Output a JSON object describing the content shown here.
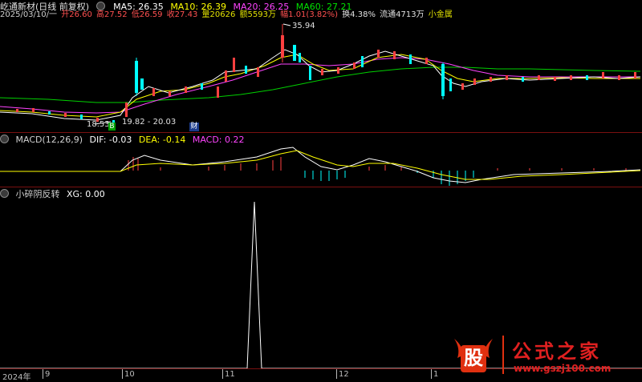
{
  "header": {
    "stock_name": "屹通新材(日线 前复权)",
    "ma5": "MA5: 26.35",
    "ma10": "MA10: 26.39",
    "ma20": "MA20: 26.25",
    "ma60": "MA60: 27.21",
    "colors": {
      "ma5": "#ffffff",
      "ma10": "#ffff00",
      "ma20": "#ff44ff",
      "ma60": "#00e000"
    }
  },
  "quote": {
    "date": "2025/03/10/一",
    "open": "开26.60",
    "high": "高27.52",
    "low": "低26.59",
    "close": "收27.43",
    "volume": "量20626",
    "amount": "额5593万",
    "change": "幅1.01(3.82%)",
    "turnover": "换4.38%",
    "float": "流通4713万",
    "sector": "小金属"
  },
  "price_panel": {
    "high_label": "35.94",
    "low_label": "18.53",
    "range_label": "19.82 - 20.03",
    "badge_b": "B",
    "badge_cai": "财"
  },
  "macd_panel": {
    "title": "MACD(12,26,9)",
    "dif": "DIF: -0.03",
    "dea": "DEA: -0.14",
    "macd": "MACD: 0.22"
  },
  "xg_panel": {
    "title": "小碎阴反转",
    "xg": "XG: 0.00"
  },
  "x_axis": {
    "labels": [
      "2024年",
      "9",
      "10",
      "11",
      "12",
      "1"
    ]
  },
  "watermark": {
    "brand": "股",
    "title": "公式之家",
    "url": "www.gszj100.com"
  }
}
